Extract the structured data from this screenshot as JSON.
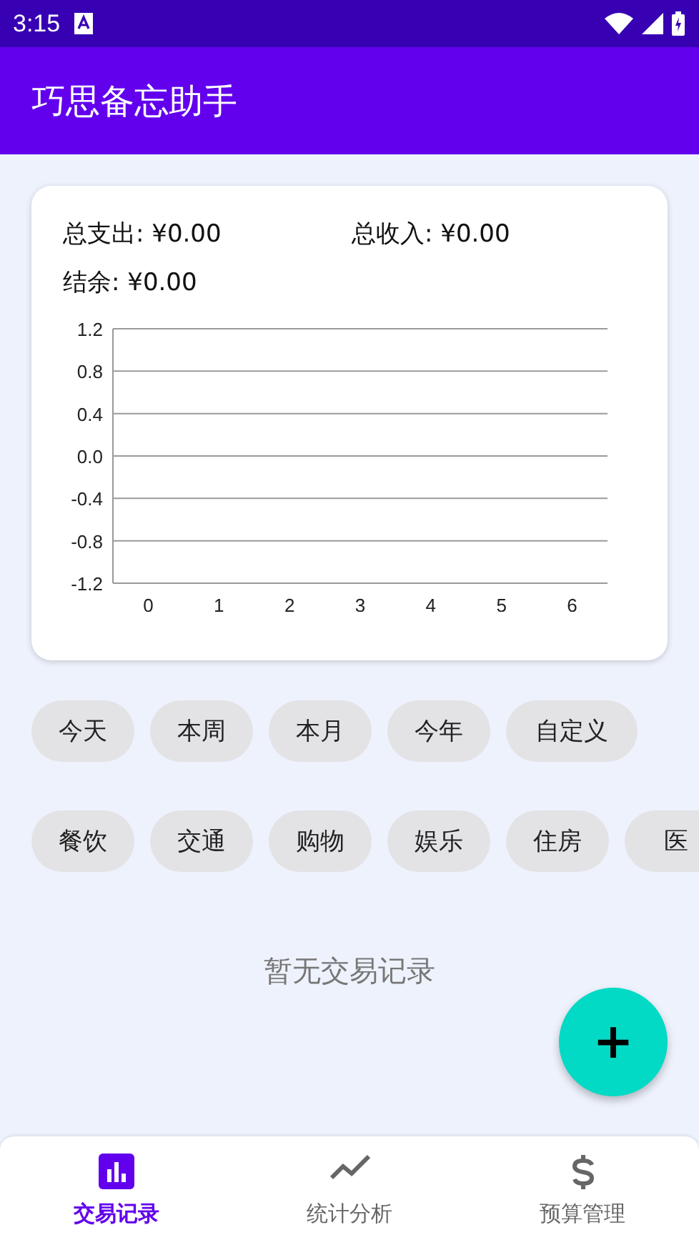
{
  "status_bar": {
    "time": "3:15"
  },
  "app_bar": {
    "title": "巧思备忘助手"
  },
  "summary": {
    "expense": "总支出: ¥0.00",
    "income": "总收入: ¥0.00",
    "balance": "结余: ¥0.00"
  },
  "chart_data": {
    "type": "line",
    "grid": true,
    "categories": [
      "0",
      "1",
      "2",
      "3",
      "4",
      "5",
      "6"
    ],
    "ylim": [
      -1.2,
      1.2
    ],
    "yticks": [
      {
        "value": 1.2,
        "label": "1.2"
      },
      {
        "value": 0.8,
        "label": "0.8"
      },
      {
        "value": 0.4,
        "label": "0.4"
      },
      {
        "value": 0,
        "label": "0.0"
      },
      {
        "value": -0.4,
        "label": "-0.4"
      },
      {
        "value": -0.8,
        "label": "-0.8"
      },
      {
        "value": -1.2,
        "label": "-1.2"
      }
    ]
  },
  "period_filters": [
    "今天",
    "本周",
    "本月",
    "今年",
    "自定义"
  ],
  "category_filters": [
    "餐饮",
    "交通",
    "购物",
    "娱乐",
    "住房",
    "医"
  ],
  "empty_message": "暂无交易记录",
  "fab": {
    "label": "+"
  },
  "tabs": [
    {
      "label": "交易记录",
      "selected": true,
      "kind": "bars"
    },
    {
      "label": "统计分析",
      "selected": false,
      "kind": "trend"
    },
    {
      "label": "预算管理",
      "selected": false,
      "kind": "dollar"
    }
  ]
}
